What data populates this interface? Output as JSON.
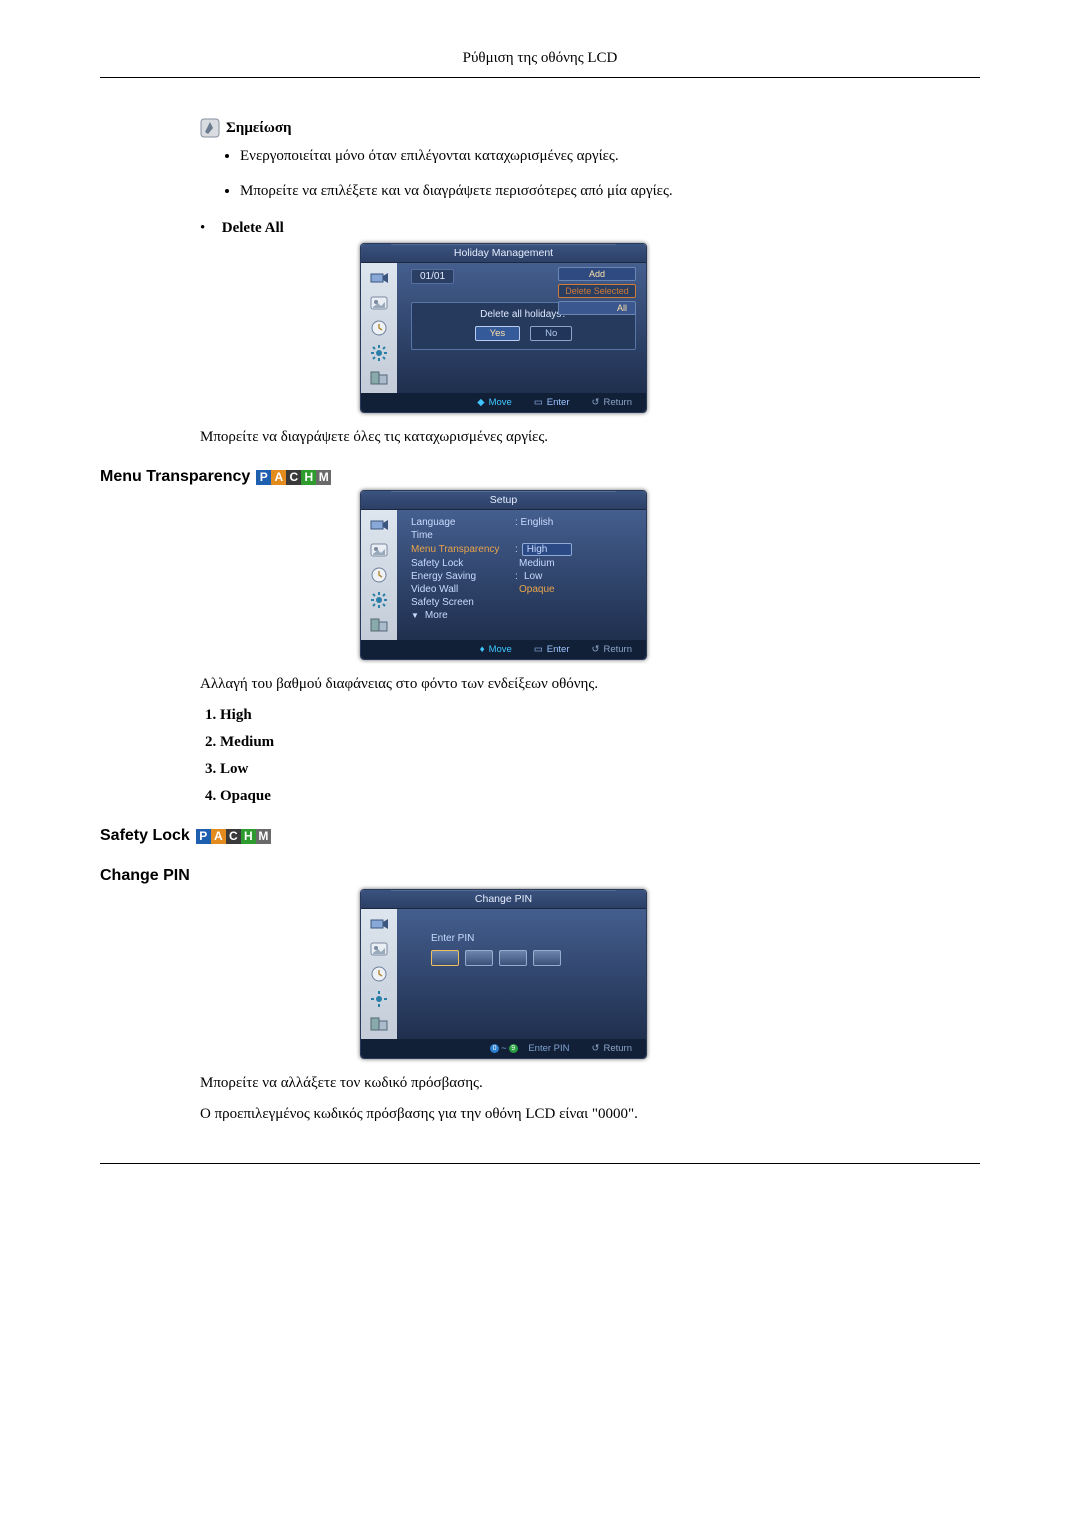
{
  "header": {
    "title": "Ρύθμιση της οθόνης LCD"
  },
  "note": {
    "label": "Σημείωση",
    "items": [
      "Ενεργοποιείται μόνο όταν επιλέγονται καταχωρισμένες αργίες.",
      "Μπορείτε να επιλέξετε και να διαγράψετε περισσότερες από μία αργίες."
    ]
  },
  "delete_all": {
    "label": "Delete All"
  },
  "osd1": {
    "title": "Holiday Management",
    "date": "01/01",
    "btn_add": "Add",
    "btn_delsel": "Delete Selected",
    "btn_all": "All",
    "dialog_q": "Delete all holidays?",
    "yes": "Yes",
    "no": "No",
    "footer": {
      "move": "Move",
      "enter": "Enter",
      "return": "Return"
    }
  },
  "delete_all_desc": "Μπορείτε να διαγράψετε όλες τις καταχωρισμένες αργίες.",
  "section_menu_transparency": "Menu Transparency",
  "osd2": {
    "title": "Setup",
    "rows": {
      "language_lbl": "Language",
      "language_val": ": English",
      "time_lbl": "Time",
      "mt_lbl": "Menu Transparency",
      "sl_lbl": "Safety Lock",
      "es_lbl": "Energy Saving",
      "vw_lbl": "Video Wall",
      "ss_lbl": "Safety Screen",
      "more_lbl": "More"
    },
    "opts": {
      "high": "High",
      "medium": "Medium",
      "low": "Low",
      "opaque": "Opaque",
      "es_val": ":"
    },
    "footer": {
      "move": "Move",
      "enter": "Enter",
      "return": "Return"
    }
  },
  "mt_desc": "Αλλαγή του βαθμού διαφάνειας στο φόντο των ενδείξεων οθόνης.",
  "mt_options": [
    "High",
    "Medium",
    "Low",
    "Opaque"
  ],
  "section_safety_lock": "Safety Lock",
  "section_change_pin": "Change PIN",
  "osd3": {
    "title": "Change PIN",
    "enter_pin": "Enter PIN",
    "footer_enter": "Enter PIN",
    "footer_return": "Return",
    "num0": "0",
    "num9": "9"
  },
  "pin_desc1": "Μπορείτε να αλλάξετε τον κωδικό πρόσβασης.",
  "pin_desc2": "Ο προεπιλεγμένος κωδικός πρόσβασης για την οθόνη LCD είναι \"0000\".",
  "pachm": {
    "p": "P",
    "a": "A",
    "c": "C",
    "h": "H",
    "m": "M"
  }
}
